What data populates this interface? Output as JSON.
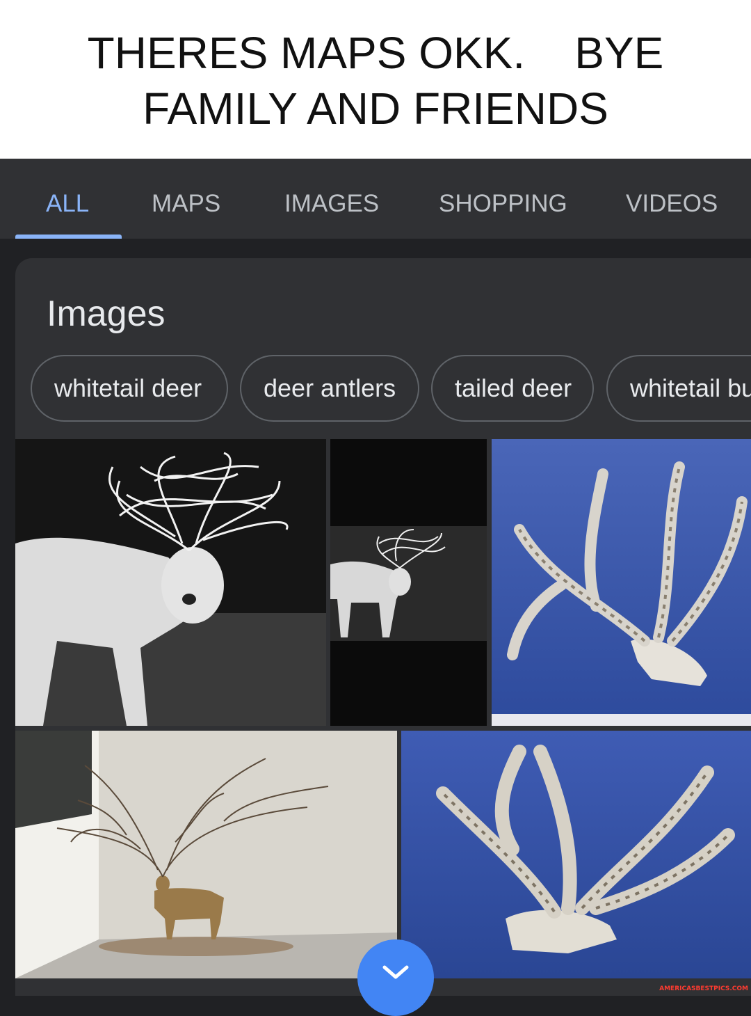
{
  "caption": {
    "line1": "THERES MAPS OKK.    BYE",
    "line2": "FAMILY AND FRIENDS"
  },
  "tabs": [
    {
      "label": "ALL",
      "active": true
    },
    {
      "label": "MAPS",
      "active": false
    },
    {
      "label": "IMAGES",
      "active": false
    },
    {
      "label": "SHOPPING",
      "active": false
    },
    {
      "label": "VIDEOS",
      "active": false
    }
  ],
  "images_card": {
    "title": "Images",
    "chips": [
      "whitetail deer",
      "deer antlers",
      "tailed deer",
      "whitetail bu"
    ]
  },
  "colors": {
    "background": "#202124",
    "surface": "#303134",
    "accent": "#8ab4f8",
    "fab": "#4285f4"
  },
  "icons": {
    "fab": "chevron-down-icon"
  },
  "watermark": "AMERICASBESTPICS.COM"
}
